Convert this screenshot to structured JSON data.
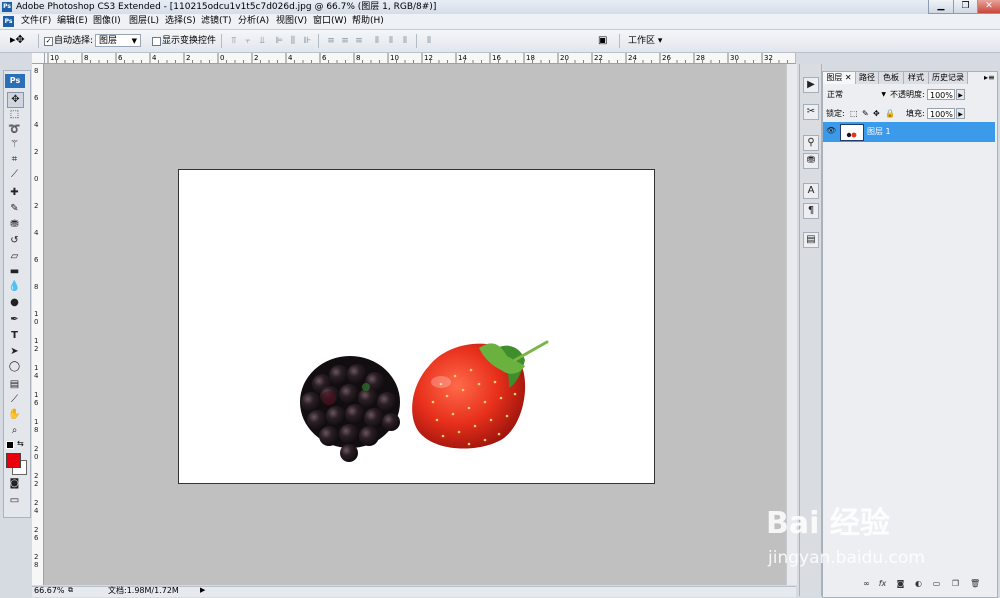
{
  "app": {
    "title": "Adobe Photoshop CS3 Extended - [110215odcu1v1t5c7d026d.jpg @ 66.7% (图层 1, RGB/8#)]",
    "icon": "Ps",
    "window_buttons": [
      "minimize-icon",
      "restore-icon",
      "close-icon"
    ]
  },
  "menu": [
    "文件(F)",
    "编辑(E)",
    "图像(I)",
    "图层(L)",
    "选择(S)",
    "滤镜(T)",
    "分析(A)",
    "视图(V)",
    "窗口(W)",
    "帮助(H)"
  ],
  "options_bar": {
    "tool_icon": "move-tool-icon",
    "auto_select_label": "自动选择:",
    "auto_select_checked": true,
    "auto_select_value": "图层",
    "show_transform_label": "显示变换控件",
    "show_transform_checked": false,
    "workspace_label": "工作区 ▾"
  },
  "toolbox": {
    "logo": "Ps",
    "tools": [
      "move-tool-icon",
      "marquee-tool-icon",
      "lasso-tool-icon",
      "magic-wand-icon",
      "crop-tool-icon",
      "slice-tool-icon",
      "healing-brush-icon",
      "brush-tool-icon",
      "clone-stamp-icon",
      "history-brush-icon",
      "eraser-icon",
      "gradient-tool-icon",
      "blur-tool-icon",
      "dodge-tool-icon",
      "pen-tool-icon",
      "type-tool-icon",
      "path-selection-icon",
      "shape-tool-icon",
      "notes-tool-icon",
      "eyedropper-icon",
      "hand-tool-icon",
      "zoom-tool-icon"
    ],
    "foreground_color": "#e8000a",
    "background_color": "#ffffff"
  },
  "rulers": {
    "top": [
      "10",
      "8",
      "6",
      "4",
      "2",
      "0",
      "2",
      "4",
      "6",
      "8",
      "10",
      "12",
      "14",
      "16",
      "18",
      "20",
      "22",
      "24",
      "26",
      "28",
      "30",
      "32",
      "34"
    ],
    "left": [
      "8",
      "6",
      "4",
      "2",
      "0",
      "2",
      "4",
      "6",
      "8",
      "10",
      "12",
      "14",
      "16",
      "18",
      "20",
      "22",
      "24",
      "26",
      "28"
    ]
  },
  "status": {
    "zoom": "66.67%",
    "doc": "文档:1.98M/1.72M"
  },
  "layers_panel": {
    "tabs": [
      "图层",
      "路径",
      "色板",
      "样式",
      "历史记录"
    ],
    "active_tab": "图层",
    "blend_mode": "正常",
    "opacity_label": "不透明度:",
    "opacity_value": "100%",
    "lock_label": "锁定:",
    "fill_label": "填充:",
    "fill_value": "100%",
    "layers": [
      {
        "name": "图层 1",
        "visible": true,
        "selected": true
      }
    ]
  },
  "watermark": {
    "brand": "Bai 经验",
    "url": "jingyan.baidu.com"
  },
  "colors": {
    "selection_blue": "#3c9aeb",
    "workspace_gray": "#c0c0c0",
    "strawberry_red": "#e8301c",
    "blackberry": "#1b1418"
  }
}
